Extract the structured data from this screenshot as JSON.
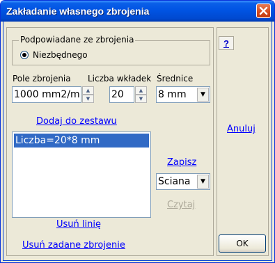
{
  "window": {
    "title": "Zakładanie własnego zbrojenia"
  },
  "suggest_group": {
    "legend": "Podpowiadane ze zbrojenia",
    "option_label": "Niezbędnego",
    "selected": true
  },
  "fields": {
    "area_label": "Pole zbrojenia",
    "area_value": "1000 mm2/m",
    "count_label": "Liczba wkładek",
    "count_value": "20",
    "diameter_label": "Średnice",
    "diameter_value": "8 mm"
  },
  "actions": {
    "add_to_set": "Dodaj do zestawu",
    "save": "Zapisz",
    "read": "Czytaj",
    "remove_line": "Usuń linię",
    "remove_reinforcement": "Usuń zadane zbrojenie",
    "cancel": "Anuluj",
    "ok": "OK",
    "help": "?"
  },
  "list": {
    "items": [
      "Liczba=20*8 mm"
    ],
    "selected_index": 0
  },
  "element_select": {
    "value": "Sciana"
  },
  "colors": {
    "title_bar": "#0054e3",
    "link": "#0000ff",
    "disabled_link": "#aca899",
    "selection": "#316ac5",
    "close_button": "#d44a1c"
  }
}
